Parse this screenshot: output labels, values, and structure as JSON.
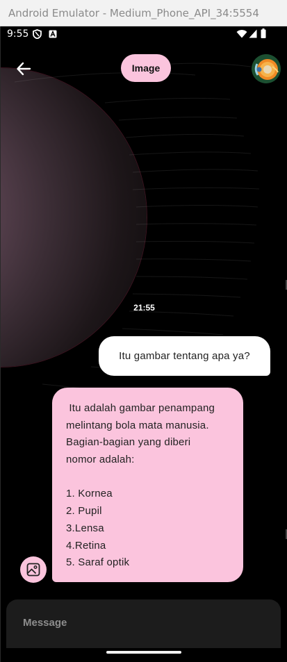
{
  "window": {
    "title": "Android Emulator - Medium_Phone_API_34:5554"
  },
  "statusbar": {
    "time": "9:55",
    "left_icons": [
      "shield-icon",
      "a-badge-icon"
    ],
    "right_icons": [
      "wifi-icon",
      "signal-icon",
      "battery-icon"
    ]
  },
  "appbar": {
    "back_icon": "arrow-back-icon",
    "title": "Image",
    "avatar": "eye-avatar"
  },
  "chat": {
    "timestamp": "21:55",
    "user_message": "Itu gambar tentang apa ya?",
    "bot_lines": [
      " Itu adalah gambar penampang",
      "melintang bola mata manusia.",
      "Bagian-bagian yang diberi",
      "nomor adalah:",
      "",
      "1. Kornea",
      "2. Pupil",
      "3.Lensa",
      "4.Retina",
      "5. Saraf optik"
    ]
  },
  "composer": {
    "image_button_icon": "image-icon",
    "placeholder": "Message"
  },
  "colors": {
    "accent_pink": "#fbc4dd",
    "background": "#000000",
    "user_bubble": "#ffffff",
    "input_bar": "#1c1c1c"
  }
}
